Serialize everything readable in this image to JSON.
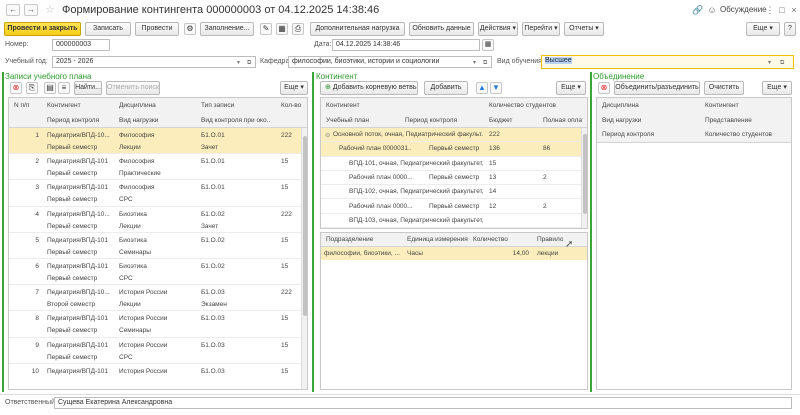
{
  "window": {
    "title": "Формирование контингента 000000003 от 04.12.2025 14:38:46",
    "discussion_label": "Обсуждение"
  },
  "toolbar": {
    "post_close": "Провести и закрыть",
    "save": "Записать",
    "post": "Провести",
    "fill": "Заполнение...",
    "extra_load": "Дополнительная нагрузка",
    "refresh": "Обновить данные",
    "actions": "Действия",
    "goto": "Перейти",
    "reports": "Отчеты",
    "more": "Еще"
  },
  "header": {
    "number_label": "Номер:",
    "number_value": "000000003",
    "date_label": "Дата:",
    "date_value": "04.12.2025 14:38:46",
    "year_label": "Учебный год:",
    "year_value": "2025 - 2026",
    "dept_label": "Кафедра:",
    "dept_value": "философии, биоэтики, истории и социологии",
    "study_label": "Вид обучения:",
    "study_value": "Высшее"
  },
  "left": {
    "title": "Записи учебного плана",
    "find": "Найти...",
    "cancel_search": "Отменить поиск",
    "more": "Еще",
    "columns": [
      "N п/п",
      "Контингент",
      "Дисциплина",
      "Тип записи",
      "Кол-во"
    ],
    "subcolumns": [
      "Период контроля",
      "Вид нагрузки",
      "Вид контроля при око..."
    ],
    "rows": [
      {
        "n": "1",
        "c": "Педиатрия/ВПД-10...",
        "d": "Философия",
        "t": "Б1.О.01",
        "q": "222",
        "p": "Первый семестр",
        "v": "Лекции",
        "k": "Зачет"
      },
      {
        "n": "2",
        "c": "Педиатрия/ВПД-101",
        "d": "Философия",
        "t": "Б1.О.01",
        "q": "15",
        "p": "Первый семестр",
        "v": "Практические",
        "k": ""
      },
      {
        "n": "3",
        "c": "Педиатрия/ВПД-101",
        "d": "Философия",
        "t": "Б1.О.01",
        "q": "15",
        "p": "Первый семестр",
        "v": "СРС",
        "k": ""
      },
      {
        "n": "4",
        "c": "Педиатрия/ВПД-10...",
        "d": "Биоэтика",
        "t": "Б1.О.02",
        "q": "222",
        "p": "Первый семестр",
        "v": "Лекции",
        "k": "Зачет"
      },
      {
        "n": "5",
        "c": "Педиатрия/ВПД-101",
        "d": "Биоэтика",
        "t": "Б1.О.02",
        "q": "15",
        "p": "Первый семестр",
        "v": "Семинары",
        "k": ""
      },
      {
        "n": "6",
        "c": "Педиатрия/ВПД-101",
        "d": "Биоэтика",
        "t": "Б1.О.02",
        "q": "15",
        "p": "Первый семестр",
        "v": "СРС",
        "k": ""
      },
      {
        "n": "7",
        "c": "Педиатрия/ВПД-10...",
        "d": "История России",
        "t": "Б1.О.03",
        "q": "222",
        "p": "Второй семестр",
        "v": "Лекции",
        "k": "Экзамен"
      },
      {
        "n": "8",
        "c": "Педиатрия/ВПД-101",
        "d": "История России",
        "t": "Б1.О.03",
        "q": "15",
        "p": "Первый семестр",
        "v": "Семинары",
        "k": ""
      },
      {
        "n": "9",
        "c": "Педиатрия/ВПД-101",
        "d": "История России",
        "t": "Б1.О.03",
        "q": "15",
        "p": "Первый семестр",
        "v": "СРС",
        "k": ""
      },
      {
        "n": "10",
        "c": "Педиатрия/ВПД-101",
        "d": "История России",
        "t": "Б1.О.03",
        "q": "15",
        "p": "",
        "v": "",
        "k": ""
      }
    ]
  },
  "middle": {
    "title": "Контингент",
    "add_root": "Добавить корневую ветвь",
    "add": "Добавить",
    "more": "Еще",
    "columns": [
      "Контингент",
      "Количество студентов"
    ],
    "subcolumns": [
      "Учебный план",
      "Период контроля",
      "Бюджет",
      "Полная оплат"
    ],
    "rows": [
      {
        "c": "Основной поток, очная, Педиатрический факульт...",
        "p": "",
        "b": "222",
        "f": ""
      },
      {
        "c": "Рабочий план 0000031...",
        "p": "Первый семестр",
        "b": "136",
        "f": "86"
      },
      {
        "c": "ВПД-101, очная, Педиатрический факультет, ...",
        "p": "",
        "b": "15",
        "f": ""
      },
      {
        "c": "Рабочий план 0000...",
        "p": "Первый семестр",
        "b": "13",
        "f": "2"
      },
      {
        "c": "ВПД-102, очная, Педиатрический факультет, ...",
        "p": "",
        "b": "14",
        "f": ""
      },
      {
        "c": "Рабочий план 0000...",
        "p": "Первый семестр",
        "b": "12",
        "f": "2"
      },
      {
        "c": "ВПД-103, очная, Педиатрический факультет, ...",
        "p": "",
        "b": "",
        "f": ""
      }
    ],
    "load_columns": [
      "Подразделение",
      "Единица измерения",
      "Количество",
      "Правило"
    ],
    "load_rows": [
      {
        "u": "философии, биоэтики, ...",
        "m": "Часы",
        "q": "14,00",
        "r": "лекции"
      }
    ]
  },
  "right": {
    "title": "Объединение",
    "combine": "Объединить/разъединить",
    "clear": "Очистить",
    "more": "Еще",
    "columns": [
      "Дисциплина",
      "Контингент"
    ],
    "subcolumns": [
      "Вид нагрузки",
      "Представление"
    ],
    "subcolumns2": [
      "Период контроля",
      "Количество студентов"
    ]
  },
  "footer": {
    "resp_label": "Ответственный:",
    "resp_value": "Сущева Екатерина Александровна"
  },
  "colors": {
    "accent": "#f5cc15",
    "section": "#2e9a2e",
    "selected": "#fbeebc"
  }
}
